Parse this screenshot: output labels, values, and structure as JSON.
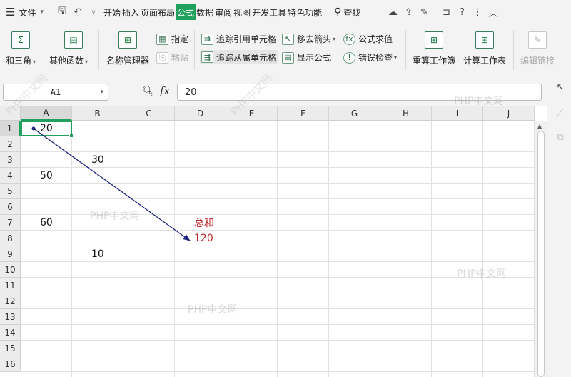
{
  "menubar": {
    "file_label": "文件",
    "tabs": [
      {
        "label": "开始"
      },
      {
        "label": "插入"
      },
      {
        "label": "页面布局"
      },
      {
        "label": "公式",
        "active": true
      },
      {
        "label": "数据"
      },
      {
        "label": "审阅"
      },
      {
        "label": "视图"
      },
      {
        "label": "开发工具"
      },
      {
        "label": "特色功能"
      }
    ],
    "search_label": "查找"
  },
  "ribbon": {
    "autosum_label": "和三角",
    "other_functions_label": "其他函数",
    "name_manager_label": "名称管理器",
    "specify_label": "指定",
    "paste_label": "粘贴",
    "trace_precedents_label": "追踪引用单元格",
    "trace_dependents_label": "追踪从属单元格",
    "remove_arrows_label": "移去箭头",
    "show_formulas_label": "显示公式",
    "evaluate_formula_label": "公式求值",
    "error_check_label": "错误检查",
    "recalc_workbook_label": "重算工作簿",
    "calc_sheet_label": "计算工作表",
    "edit_links_label": "编辑链接"
  },
  "formula_bar": {
    "cell_ref": "A1",
    "fx_label": "fx",
    "value": "20"
  },
  "sheet": {
    "columns": [
      "A",
      "B",
      "C",
      "D",
      "E",
      "F",
      "G",
      "H",
      "I",
      "J"
    ],
    "rows": [
      "1",
      "2",
      "3",
      "4",
      "5",
      "6",
      "7",
      "8",
      "9",
      "10",
      "11",
      "12",
      "13",
      "14",
      "15",
      "16"
    ],
    "selected_cell": "A1",
    "cells": [
      {
        "ref": "A1",
        "value": "20"
      },
      {
        "ref": "B3",
        "value": "30"
      },
      {
        "ref": "A4",
        "value": "50"
      },
      {
        "ref": "A7",
        "value": "60"
      },
      {
        "ref": "D7",
        "value": "总和",
        "color": "#c0272d"
      },
      {
        "ref": "D8",
        "value": "120",
        "color": "#c0272d"
      },
      {
        "ref": "B9",
        "value": "10"
      }
    ],
    "tracer_arrow": {
      "from": "A1",
      "to": "D8",
      "color": "#1a237e"
    }
  },
  "watermark": "PHP中文网",
  "colors": {
    "accent": "#1fa15b",
    "sum_text": "#c0272d",
    "arrow": "#1a237e"
  }
}
